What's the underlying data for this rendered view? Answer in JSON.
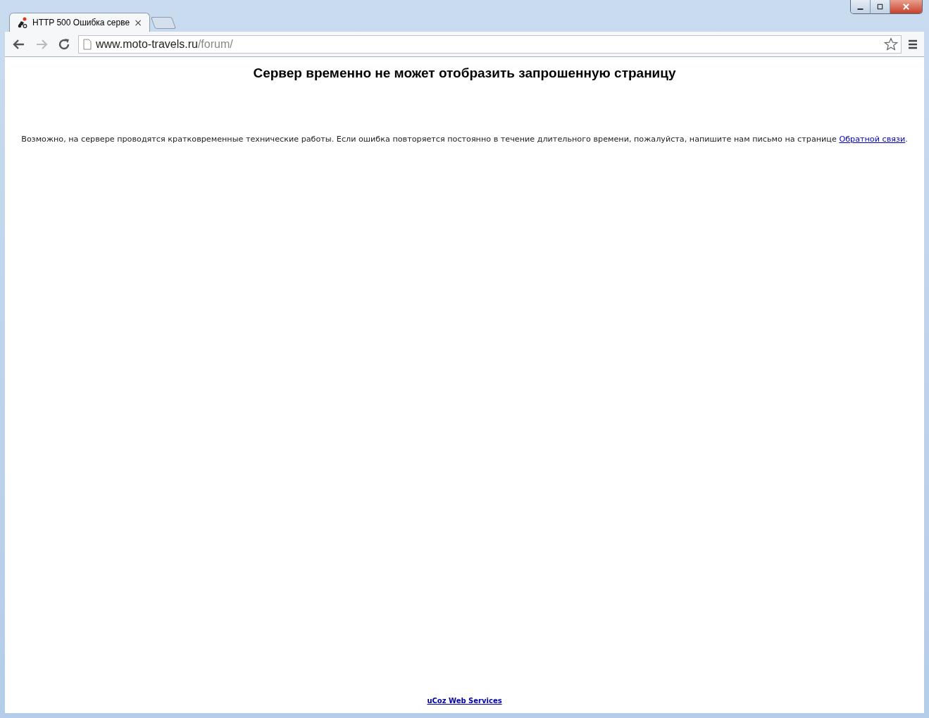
{
  "tabs": [
    {
      "title": "HTTP 500 Ошибка серве",
      "close": "×",
      "selected": true
    }
  ],
  "address_bar": {
    "host": "www.moto-travels.ru",
    "path": "/forum/"
  },
  "page": {
    "heading": "Сервер временно не может отобразить запрошенную страницу",
    "message": {
      "text": "Возможно, на сервере проводятся кратковременные технические работы. Если ошибка повторяется постоянно в течение длительного времени, пожалуйста, напишите нам письмо на странице ",
      "link": "Обратной связи",
      "end": "."
    },
    "footer_link": "uCoz Web Services"
  }
}
